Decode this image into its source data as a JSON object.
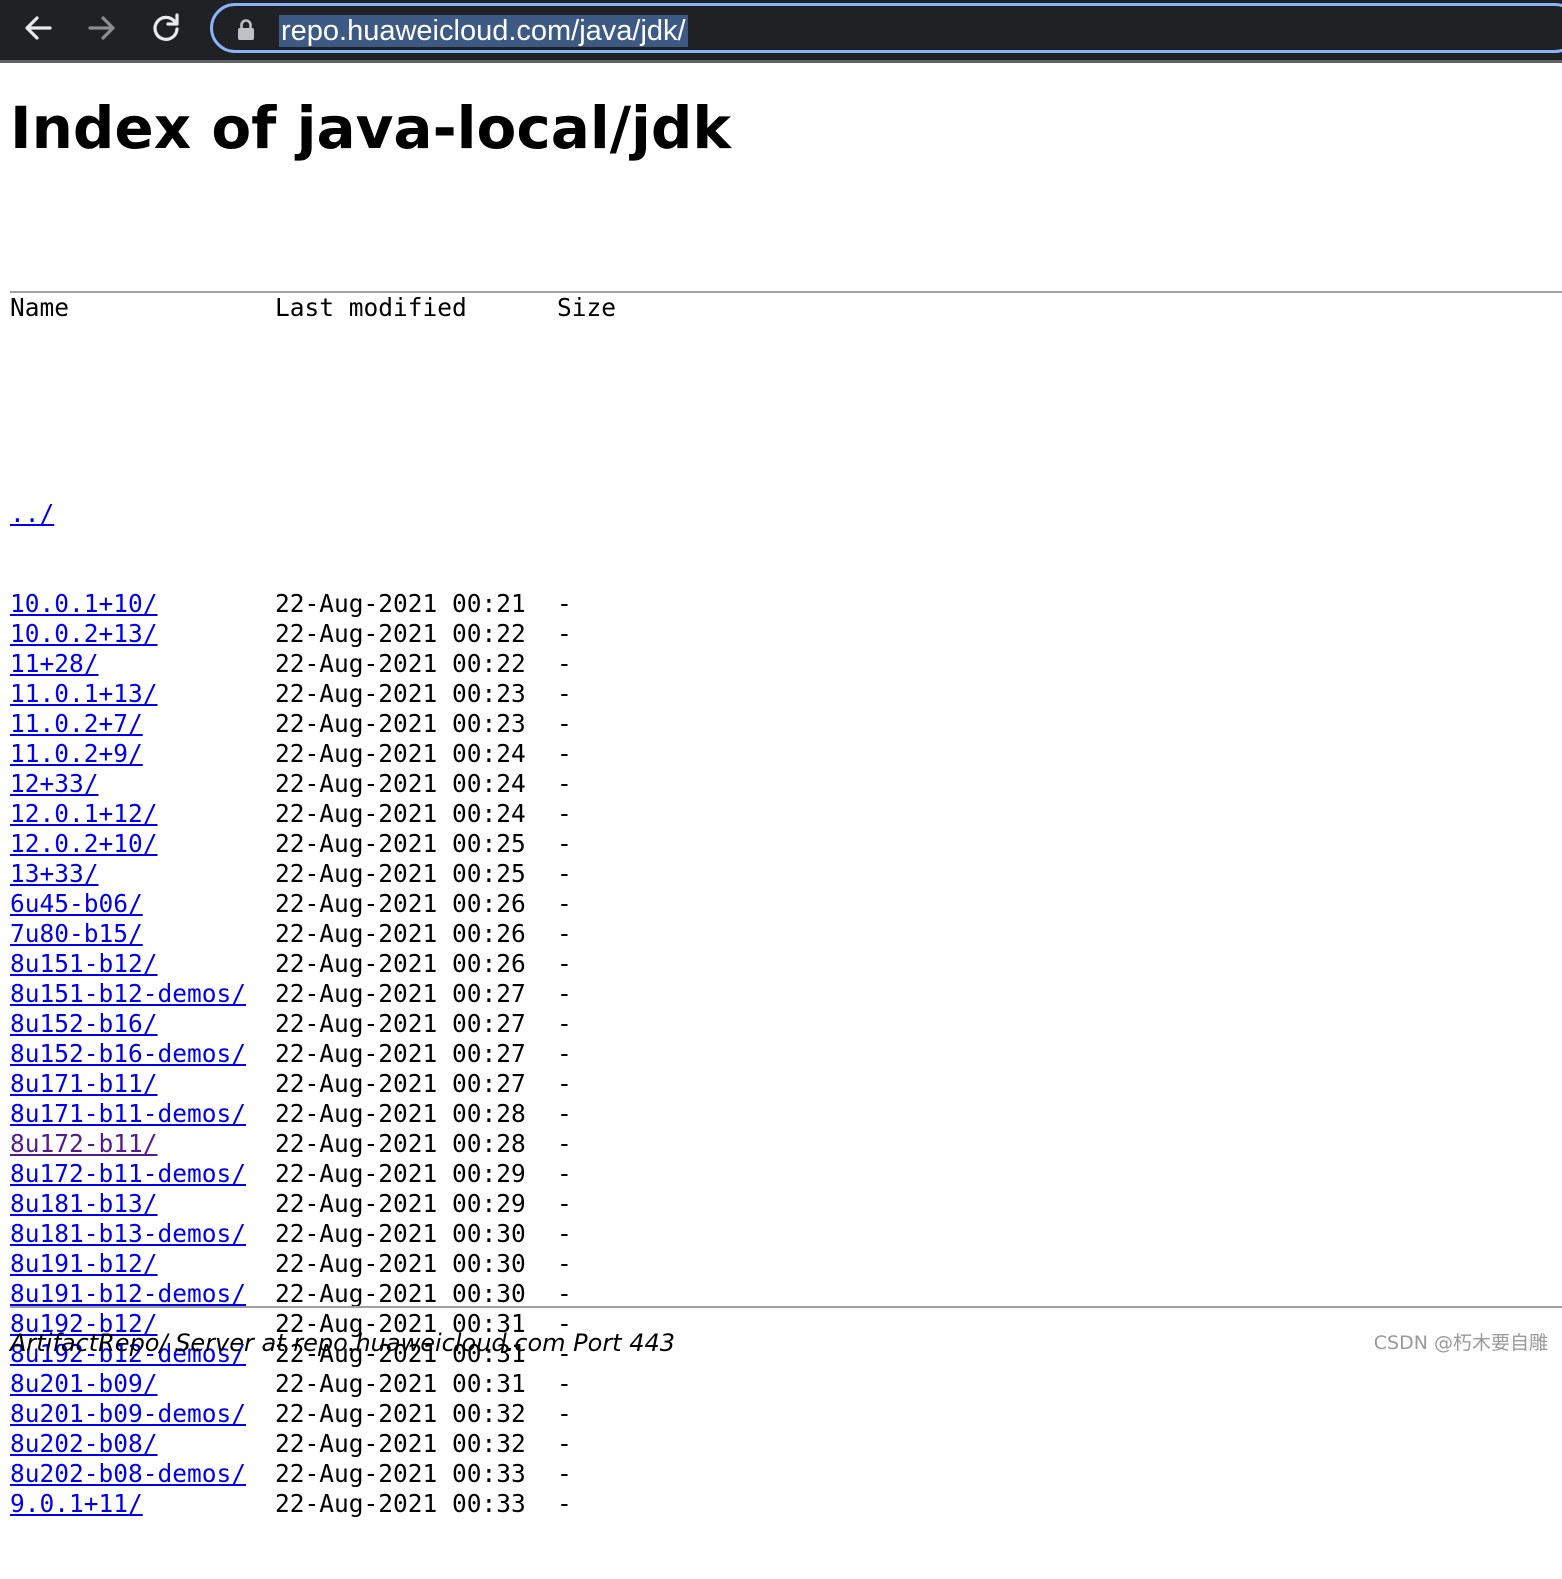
{
  "browser": {
    "url": "repo.huaweicloud.com/java/jdk/"
  },
  "page": {
    "title": "Index of java-local/jdk",
    "columns": {
      "name": "Name",
      "modified": "Last modified",
      "size": "Size"
    },
    "parent_link": "../",
    "entries": [
      {
        "name": "10.0.1+10/",
        "modified": "22-Aug-2021 00:21",
        "size": "-"
      },
      {
        "name": "10.0.2+13/",
        "modified": "22-Aug-2021 00:22",
        "size": "-"
      },
      {
        "name": "11+28/",
        "modified": "22-Aug-2021 00:22",
        "size": "-"
      },
      {
        "name": "11.0.1+13/",
        "modified": "22-Aug-2021 00:23",
        "size": "-"
      },
      {
        "name": "11.0.2+7/",
        "modified": "22-Aug-2021 00:23",
        "size": "-"
      },
      {
        "name": "11.0.2+9/",
        "modified": "22-Aug-2021 00:24",
        "size": "-"
      },
      {
        "name": "12+33/",
        "modified": "22-Aug-2021 00:24",
        "size": "-"
      },
      {
        "name": "12.0.1+12/",
        "modified": "22-Aug-2021 00:24",
        "size": "-"
      },
      {
        "name": "12.0.2+10/",
        "modified": "22-Aug-2021 00:25",
        "size": "-"
      },
      {
        "name": "13+33/",
        "modified": "22-Aug-2021 00:25",
        "size": "-"
      },
      {
        "name": "6u45-b06/",
        "modified": "22-Aug-2021 00:26",
        "size": "-"
      },
      {
        "name": "7u80-b15/",
        "modified": "22-Aug-2021 00:26",
        "size": "-"
      },
      {
        "name": "8u151-b12/",
        "modified": "22-Aug-2021 00:26",
        "size": "-"
      },
      {
        "name": "8u151-b12-demos/",
        "modified": "22-Aug-2021 00:27",
        "size": "-"
      },
      {
        "name": "8u152-b16/",
        "modified": "22-Aug-2021 00:27",
        "size": "-"
      },
      {
        "name": "8u152-b16-demos/",
        "modified": "22-Aug-2021 00:27",
        "size": "-"
      },
      {
        "name": "8u171-b11/",
        "modified": "22-Aug-2021 00:27",
        "size": "-"
      },
      {
        "name": "8u171-b11-demos/",
        "modified": "22-Aug-2021 00:28",
        "size": "-"
      },
      {
        "name": "8u172-b11/",
        "modified": "22-Aug-2021 00:28",
        "size": "-",
        "visited": true
      },
      {
        "name": "8u172-b11-demos/",
        "modified": "22-Aug-2021 00:29",
        "size": "-"
      },
      {
        "name": "8u181-b13/",
        "modified": "22-Aug-2021 00:29",
        "size": "-"
      },
      {
        "name": "8u181-b13-demos/",
        "modified": "22-Aug-2021 00:30",
        "size": "-"
      },
      {
        "name": "8u191-b12/",
        "modified": "22-Aug-2021 00:30",
        "size": "-"
      },
      {
        "name": "8u191-b12-demos/",
        "modified": "22-Aug-2021 00:30",
        "size": "-"
      },
      {
        "name": "8u192-b12/",
        "modified": "22-Aug-2021 00:31",
        "size": "-"
      },
      {
        "name": "8u192-b12-demos/",
        "modified": "22-Aug-2021 00:31",
        "size": "-"
      },
      {
        "name": "8u201-b09/",
        "modified": "22-Aug-2021 00:31",
        "size": "-"
      },
      {
        "name": "8u201-b09-demos/",
        "modified": "22-Aug-2021 00:32",
        "size": "-"
      },
      {
        "name": "8u202-b08/",
        "modified": "22-Aug-2021 00:32",
        "size": "-"
      },
      {
        "name": "8u202-b08-demos/",
        "modified": "22-Aug-2021 00:33",
        "size": "-"
      },
      {
        "name": "9.0.1+11/",
        "modified": "22-Aug-2021 00:33",
        "size": "-"
      }
    ],
    "server_address": "ArtifactRepo/ Server at repo.huaweicloud.com Port 443"
  },
  "watermark": "CSDN @朽木要自雕",
  "icons": [
    "back-arrow-icon",
    "forward-arrow-icon",
    "reload-icon",
    "lock-icon"
  ],
  "colors": {
    "toolbar_bg": "#202124",
    "omnibox_border": "#8ab4f8",
    "link": "#0000ee",
    "visited_link": "#551a8b"
  }
}
